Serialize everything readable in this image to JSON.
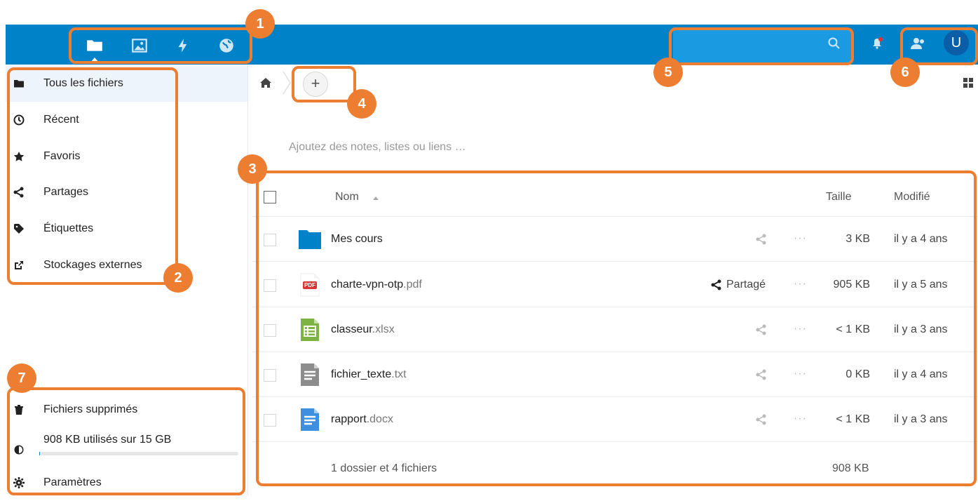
{
  "header": {
    "apps": [
      {
        "name": "files",
        "icon": "folder-icon"
      },
      {
        "name": "photos",
        "icon": "image-icon"
      },
      {
        "name": "activity",
        "icon": "lightning-icon"
      },
      {
        "name": "circles",
        "icon": "globe-icon"
      }
    ],
    "avatar_letter": "U"
  },
  "sidebar": {
    "items": [
      {
        "label": "Tous les fichiers",
        "icon": "folder-icon"
      },
      {
        "label": "Récent",
        "icon": "clock-icon"
      },
      {
        "label": "Favoris",
        "icon": "star-icon"
      },
      {
        "label": "Partages",
        "icon": "share-icon"
      },
      {
        "label": "Étiquettes",
        "icon": "tag-icon"
      },
      {
        "label": "Stockages externes",
        "icon": "external-link-icon"
      }
    ],
    "bottom": {
      "deleted_label": "Fichiers supprimés",
      "quota_label": "908 KB utilisés sur 15 GB",
      "quota_fraction": 0.0001,
      "settings_label": "Paramètres"
    }
  },
  "main": {
    "add_label": "+",
    "rich_workspace_placeholder": "Ajoutez des notes, listes ou liens …",
    "columns": {
      "name": "Nom",
      "size": "Taille",
      "modified": "Modifié"
    },
    "files": [
      {
        "base": "Mes cours",
        "ext": "",
        "type": "folder",
        "shared_label": "",
        "size": "3 KB",
        "modified": "il y a 4 ans"
      },
      {
        "base": "charte-vpn-otp",
        "ext": ".pdf",
        "type": "pdf",
        "shared_label": "Partagé",
        "size": "905 KB",
        "modified": "il y a 5 ans"
      },
      {
        "base": "classeur",
        "ext": ".xlsx",
        "type": "spreadsheet",
        "shared_label": "",
        "size": "< 1 KB",
        "modified": "il y a 3 ans"
      },
      {
        "base": "fichier_texte",
        "ext": ".txt",
        "type": "text",
        "shared_label": "",
        "size": "0 KB",
        "modified": "il y a 4 ans"
      },
      {
        "base": "rapport",
        "ext": ".docx",
        "type": "document",
        "shared_label": "",
        "size": "< 1 KB",
        "modified": "il y a 3 ans"
      }
    ],
    "summary": {
      "text": "1 dossier et 4 fichiers",
      "size": "908 KB"
    },
    "pdf_badge": "PDF"
  },
  "annotations": [
    "1",
    "2",
    "3",
    "4",
    "5",
    "6",
    "7"
  ],
  "colors": {
    "header": "#0082c9",
    "annotation": "#ed7d31",
    "folder": "#0082c9"
  }
}
